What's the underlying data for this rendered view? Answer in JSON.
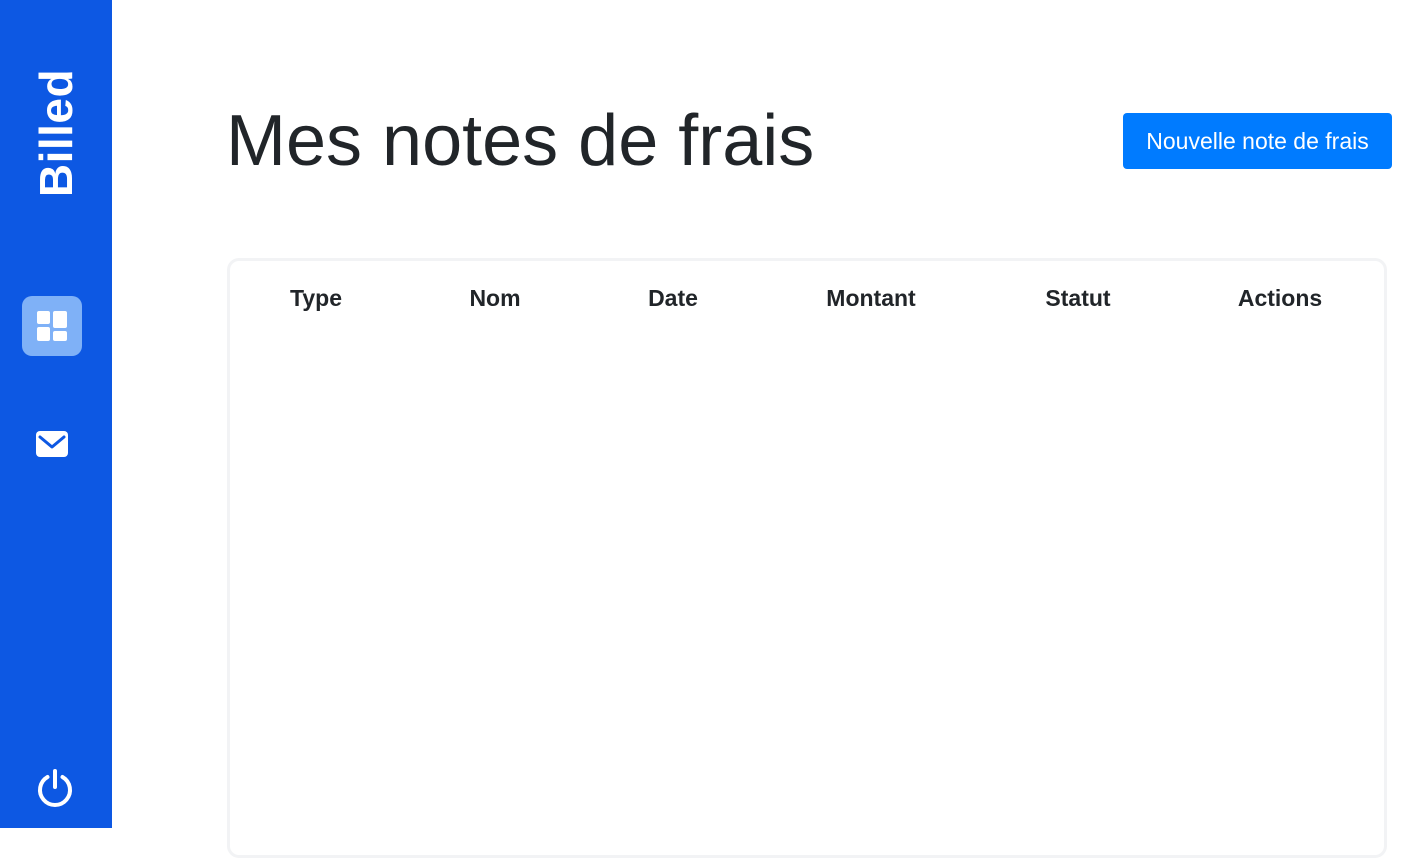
{
  "sidebar": {
    "logo": "Billed",
    "icons": {
      "dashboard": "window-icon",
      "mail": "mail-icon",
      "logout": "power-icon"
    },
    "colors": {
      "background": "#0d58e3",
      "active_item": "#7fb1f7"
    }
  },
  "main": {
    "title": "Mes notes de frais",
    "new_bill_button": "Nouvelle note de frais",
    "table": {
      "columns": [
        "Type",
        "Nom",
        "Date",
        "Montant",
        "Statut",
        "Actions"
      ],
      "rows": []
    }
  },
  "colors": {
    "primary_button": "#007bff",
    "text": "#212529"
  }
}
